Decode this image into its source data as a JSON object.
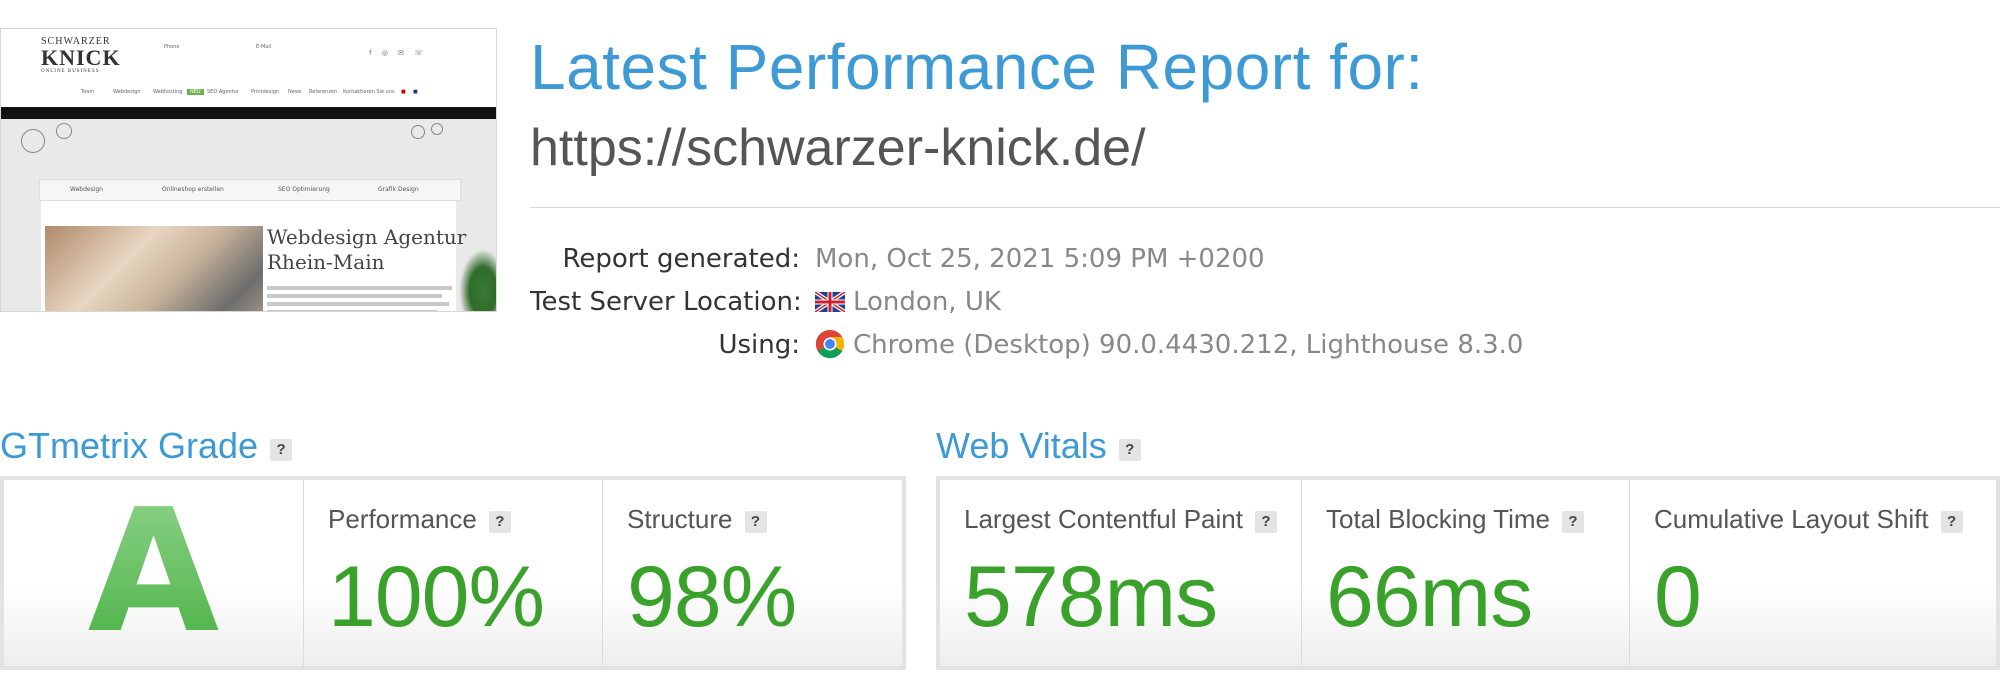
{
  "header": {
    "title": "Latest Performance Report for:",
    "url": "https://schwarzer-knick.de/"
  },
  "meta": {
    "report_generated_label": "Report generated:",
    "report_generated_value": "Mon, Oct 25, 2021 5:09 PM +0200",
    "location_label": "Test Server Location:",
    "location_value": "London, UK",
    "location_flag_icon": "uk-flag-icon",
    "using_label": "Using:",
    "using_value": "Chrome (Desktop) 90.0.4430.212, Lighthouse 8.3.0",
    "using_icon": "chrome-icon"
  },
  "thumbnail": {
    "logo_top": "SCHWARZER",
    "logo_main": "KNICK",
    "logo_sub": "ONLINE BUSINESS",
    "phone_label": "Phone",
    "email_label": "E-Mail",
    "menu": [
      "Team",
      "Webdesign",
      "Webhosting",
      "SEO Agentur",
      "Printdesign",
      "News",
      "Referenzen",
      "Kontaktieren Sie uns"
    ],
    "menu_badge": "NEU",
    "tabs": [
      "Webdesign",
      "Onlineshop erstellen",
      "SEO Optimierung",
      "Grafik Design"
    ],
    "hero_heading_line1": "Webdesign Agentur",
    "hero_heading_line2": "Rhein-Main"
  },
  "gtmetrix": {
    "section_title": "GTmetrix Grade",
    "help": "?",
    "grade": "A",
    "performance_label": "Performance",
    "performance_value": "100%",
    "structure_label": "Structure",
    "structure_value": "98%"
  },
  "web_vitals": {
    "section_title": "Web Vitals",
    "help": "?",
    "lcp_label": "Largest Contentful Paint",
    "lcp_value": "578ms",
    "tbt_label": "Total Blocking Time",
    "tbt_value": "66ms",
    "cls_label": "Cumulative Layout Shift",
    "cls_value": "0"
  },
  "colors": {
    "accent_blue": "#3d9ad4",
    "good_green": "#3aa22a",
    "grade_green": "#5cbf57"
  }
}
